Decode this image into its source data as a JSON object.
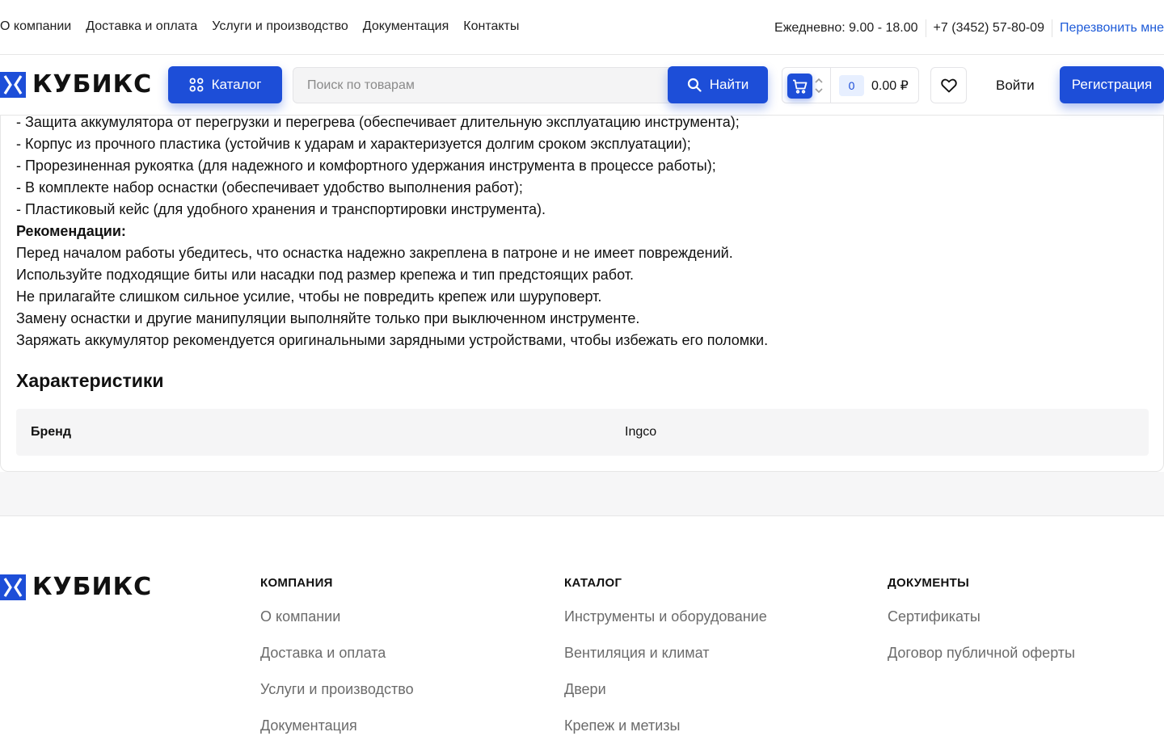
{
  "topbar": {
    "nav": [
      "О компании",
      "Доставка и оплата",
      "Услуги и производство",
      "Документация",
      "Контакты"
    ],
    "hours": "Ежедневно: 9.00 - 18.00",
    "phone": "+7 (3452) 57-80-09",
    "callback": "Перезвонить мне"
  },
  "header": {
    "logo_text": "КУБИКС",
    "catalog_label": "Каталог",
    "search_placeholder": "Поиск по товарам",
    "find_label": "Найти",
    "cart_count": "0",
    "cart_sum": "0.00 ₽",
    "login_label": "Войти",
    "register_label": "Регистрация"
  },
  "description": {
    "lines": [
      "- Защита аккумулятора от перегрузки и перегрева (обеспечивает длительную эксплуатацию инструмента);",
      "- Корпус из прочного пластика (устойчив к ударам и характеризуется долгим сроком эксплуатации);",
      "- Прорезиненная рукоятка (для надежного и комфортного удержания инструмента в процессе работы);",
      "- В комплекте набор оснастки (обеспечивает удобство выполнения работ);",
      "- Пластиковый кейс (для удобного хранения и транспортировки инструмента)."
    ],
    "recommendations_title": "Рекомендации:",
    "recommendations": [
      "Перед началом работы убедитесь, что оснастка надежно закреплена в патроне и не имеет повреждений.",
      "Используйте подходящие биты или насадки под размер крепежа и тип предстоящих работ.",
      "Не прилагайте слишком сильное усилие, чтобы не повредить крепеж или шуруповерт.",
      "Замену оснастки и другие манипуляции выполняйте только при выключенном инструменте.",
      "Заряжать аккумулятор рекомендуется оригинальными зарядными устройствами, чтобы избежать его поломки."
    ]
  },
  "characteristics": {
    "title": "Характеристики",
    "rows": [
      {
        "key": "Бренд",
        "value": "Ingco"
      }
    ]
  },
  "footer": {
    "logo_text": "КУБИКС",
    "company": {
      "title": "КОМПАНИЯ",
      "links": [
        "О компании",
        "Доставка и оплата",
        "Услуги и производство",
        "Документация"
      ]
    },
    "catalog": {
      "title": "КАТАЛОГ",
      "links": [
        "Инструменты и оборудование",
        "Вентиляция и климат",
        "Двери",
        "Крепеж и метизы"
      ]
    },
    "documents": {
      "title": "ДОКУМЕНТЫ",
      "links": [
        "Сертификаты",
        "Договор публичной оферты"
      ]
    }
  },
  "colors": {
    "accent": "#1d4ed8",
    "link": "#1e5bd8",
    "muted": "#6b6b6b"
  }
}
